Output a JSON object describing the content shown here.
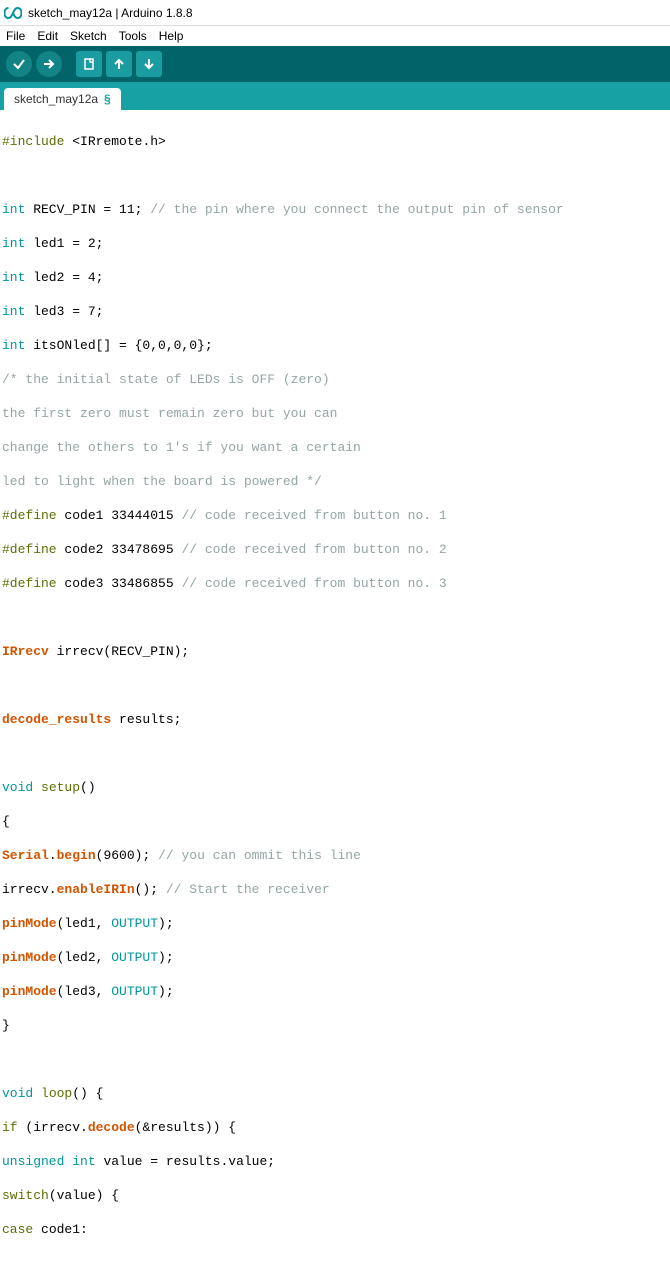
{
  "window": {
    "title": "sketch_may12a | Arduino 1.8.8"
  },
  "menu": {
    "file": "File",
    "edit": "Edit",
    "sketch": "Sketch",
    "tools": "Tools",
    "help": "Help"
  },
  "tabs": {
    "active": {
      "label": "sketch_may12a",
      "modified": "§"
    }
  },
  "icons": {
    "verify": "verify",
    "upload": "upload",
    "new": "new",
    "open": "open",
    "save": "save"
  },
  "code": {
    "l01_include": "#include",
    "l01_lib": "<IRremote.h>",
    "l03_type": "int",
    "l03_rest": " RECV_PIN = 11; ",
    "l03_com": "// the pin where you connect the output pin of sensor",
    "l04_type": "int",
    "l04_rest": " led1 = 2;",
    "l05_type": "int",
    "l05_rest": " led2 = 4;",
    "l06_type": "int",
    "l06_rest": " led3 = 7;",
    "l07_type": "int",
    "l07_rest": " itsONled[] = {0,0,0,0};",
    "l08_com": "/* the initial state of LEDs is OFF (zero)",
    "l09_com": "the first zero must remain zero but you can",
    "l10_com": "change the others to 1's if you want a certain",
    "l11_com": "led to light when the board is powered */",
    "l12_def": "#define",
    "l12_rest": " code1 33444015 ",
    "l12_com": "// code received from button no. 1",
    "l13_def": "#define",
    "l13_rest": " code2 33478695 ",
    "l13_com": "// code received from button no. 2",
    "l14_def": "#define",
    "l14_rest": " code3 33486855 ",
    "l14_com": "// code received from button no. 3",
    "l16_cls": "IRrecv",
    "l16_rest": " irrecv(RECV_PIN);",
    "l18_cls": "decode_results",
    "l18_rest": " results;",
    "l20_kw": "void",
    "l20_fn": "setup",
    "l20_rest": "()",
    "l21_brace": "{",
    "l22_cls": "Serial",
    "l22_dot": ".",
    "l22_m": "begin",
    "l22_rest": "(9600); ",
    "l22_com": "// you can ommit this line",
    "l23_obj": "irrecv.",
    "l23_m": "enableIRIn",
    "l23_rest": "(); ",
    "l23_com": "// Start the receiver",
    "l24_fn": "pinMode",
    "l24_rest": "(led1, ",
    "l24_c": "OUTPUT",
    "l24_end": ");",
    "l25_fn": "pinMode",
    "l25_rest": "(led2, ",
    "l25_c": "OUTPUT",
    "l25_end": ");",
    "l26_fn": "pinMode",
    "l26_rest": "(led3, ",
    "l26_c": "OUTPUT",
    "l26_end": ");",
    "l27_brace": "}",
    "l29_kw": "void",
    "l29_fn": "loop",
    "l29_rest": "() {",
    "l30_kw": "if",
    "l30_rest": " (irrecv.",
    "l30_m": "decode",
    "l30_rest2": "(&results)) {",
    "l31_type": "unsigned",
    "l31_type2": "int",
    "l31_rest": " value = results.value;",
    "l32_kw": "switch",
    "l32_rest": "(value) {",
    "l33_kw": "case",
    "l33_rest": " code1:"
  }
}
